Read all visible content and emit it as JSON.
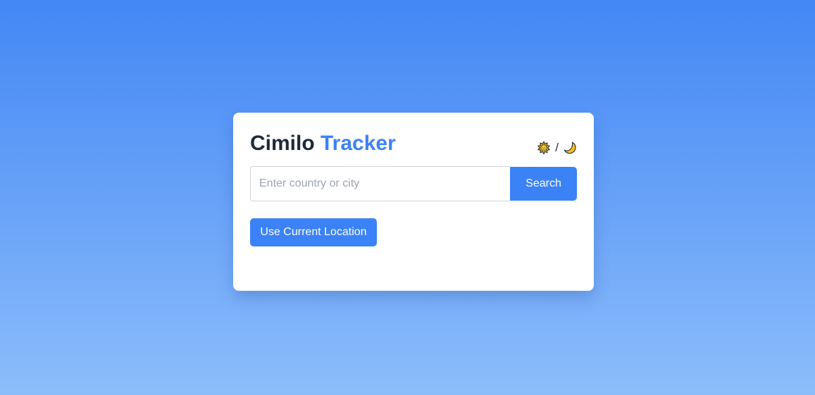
{
  "app": {
    "title_primary": "Cimilo",
    "title_accent": "Tracker"
  },
  "theme_toggle": {
    "light_icon": "sun-icon",
    "separator": "/",
    "dark_icon": "moon-icon"
  },
  "search": {
    "value": "",
    "placeholder": "Enter country or city",
    "button_label": "Search"
  },
  "location": {
    "button_label": "Use Current Location"
  },
  "colors": {
    "accent": "#3b82f6",
    "background_top": "#4387f5",
    "background_bottom": "#8cbdfb",
    "card": "#ffffff",
    "text": "#1f2937"
  }
}
